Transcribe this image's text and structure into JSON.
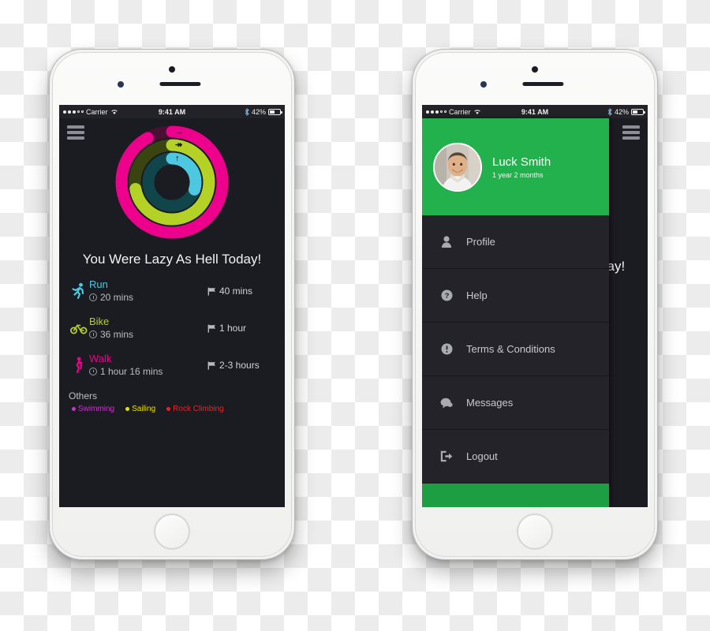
{
  "status_bar": {
    "carrier": "Carrier",
    "time": "9:41 AM",
    "battery_percent": "42%",
    "signal_filled": 3,
    "signal_empty": 2,
    "wifi_icon": "wifi-icon",
    "bluetooth_icon": "bluetooth-icon",
    "battery_icon": "battery-icon"
  },
  "dashboard": {
    "menu_icon": "hamburger-menu-icon",
    "headline": "You Were Lazy As Hell Today!",
    "rings": [
      {
        "name": "outer-ring",
        "color": "#ec008c",
        "track": "#4a1034",
        "percent": 92,
        "glyph": "→"
      },
      {
        "name": "middle-ring",
        "color": "#b4d226",
        "track": "#3a4410",
        "percent": 72,
        "glyph": "↠"
      },
      {
        "name": "inner-ring",
        "color": "#4cc8e0",
        "track": "#10454c",
        "percent": 30,
        "glyph": "↑"
      }
    ],
    "activities": [
      {
        "name": "Run",
        "color": "#4cc8e0",
        "icon": "run-icon",
        "time": "20 mins",
        "goal": "40 mins"
      },
      {
        "name": "Bike",
        "color": "#b4d226",
        "icon": "bike-icon",
        "time": "36 mins",
        "goal": "1 hour"
      },
      {
        "name": "Walk",
        "color": "#ec008c",
        "icon": "walk-icon",
        "time": "1 hour 16  mins",
        "goal": "2-3 hours"
      }
    ],
    "others_title": "Others",
    "others": [
      {
        "label": "Swimming",
        "color": "#cc33cc"
      },
      {
        "label": "Sailing",
        "color": "#e8e000"
      },
      {
        "label": "Rock Climbing",
        "color": "#ee2222"
      }
    ]
  },
  "drawer": {
    "menu_icon": "hamburger-menu-icon",
    "header_color": "#22b14c",
    "user": {
      "name": "Luck Smith",
      "subtitle": "1 year 2 months",
      "avatar": "user-photo-avatar"
    },
    "items": [
      {
        "label": "Profile",
        "icon": "person-icon"
      },
      {
        "label": "Help",
        "icon": "question-circle-icon"
      },
      {
        "label": "Terms & Conditions",
        "icon": "exclamation-circle-icon"
      },
      {
        "label": "Messages",
        "icon": "chat-bubble-icon"
      },
      {
        "label": "Logout",
        "icon": "logout-icon"
      }
    ]
  }
}
